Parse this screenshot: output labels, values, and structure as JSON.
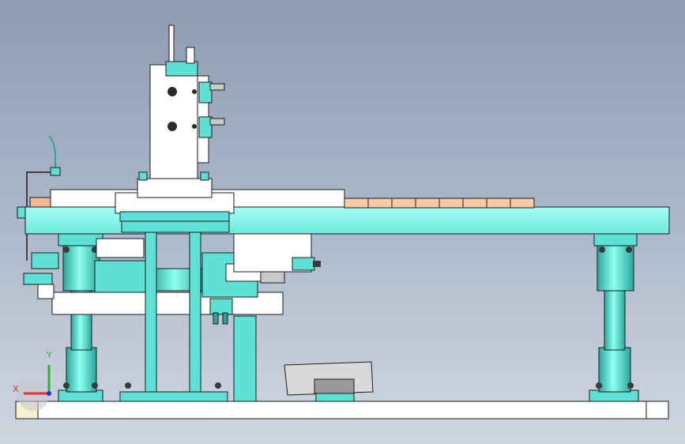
{
  "viewport": {
    "background_top": "#8d9bb3",
    "background_bottom": "#cfd6e0"
  },
  "colors": {
    "teal": "#5fe0d6",
    "teal_dark": "#2aa69c",
    "mint": "#8ffff0",
    "steel": "#ffffff",
    "outline": "#1b1b1b",
    "pad": "#f7c9a7",
    "accent_orange": "#f0b895",
    "base_plate": "#ffffff",
    "base_end": "#f5f0d0"
  },
  "triad": {
    "x_label": "X",
    "y_label": "Y",
    "x_color": "#e03030",
    "y_color": "#28b828",
    "z_color": "#2030e0"
  },
  "parts": {
    "pads": [
      "pad-1",
      "pad-2",
      "pad-3",
      "pad-4",
      "pad-5",
      "pad-6",
      "pad-7",
      "pad-8"
    ]
  }
}
